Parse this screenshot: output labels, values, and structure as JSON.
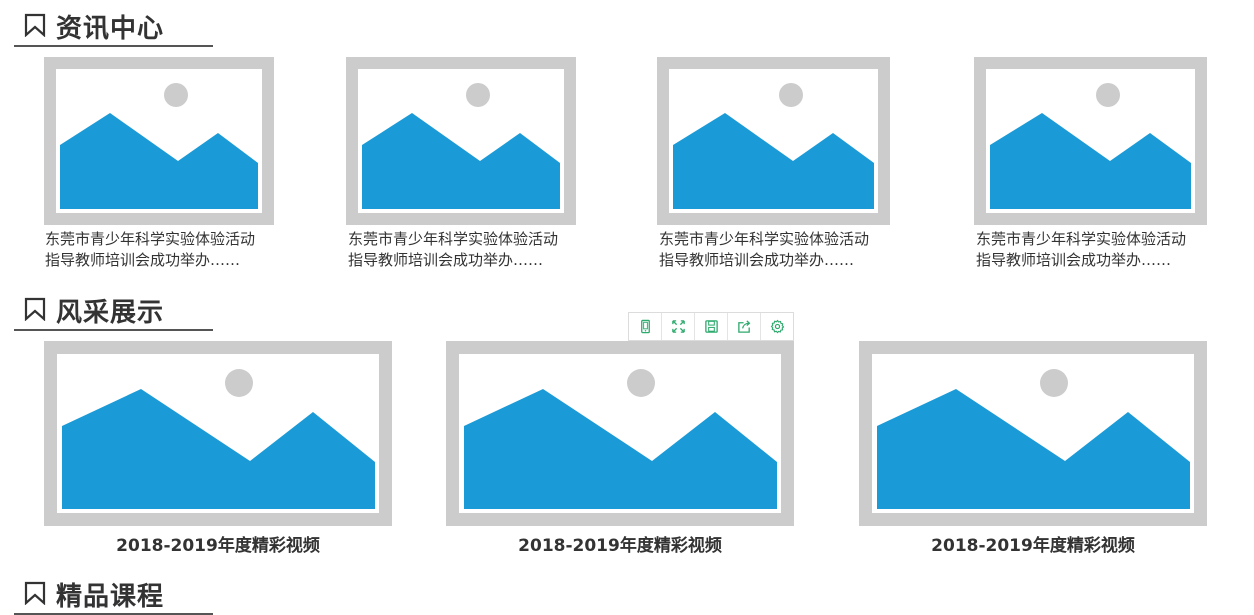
{
  "sections": {
    "news": {
      "title": "资讯中心"
    },
    "showcase": {
      "title": "风采展示"
    },
    "courses": {
      "title": "精品课程"
    }
  },
  "news_items": [
    {
      "line1": "东莞市青少年科学实验体验活动",
      "line2": "指导教师培训会成功举办……"
    },
    {
      "line1": "东莞市青少年科学实验体验活动",
      "line2": "指导教师培训会成功举办……"
    },
    {
      "line1": "东莞市青少年科学实验体验活动",
      "line2": "指导教师培训会成功举办……"
    },
    {
      "line1": "东莞市青少年科学实验体验活动",
      "line2": "指导教师培训会成功举办……"
    }
  ],
  "video_items": [
    {
      "caption": "2018-2019年度精彩视频"
    },
    {
      "caption": "2018-2019年度精彩视频"
    },
    {
      "caption": "2018-2019年度精彩视频"
    }
  ],
  "toolbar": {
    "tools": [
      {
        "icon": "mobile-icon"
      },
      {
        "icon": "expand-icon"
      },
      {
        "icon": "save-icon"
      },
      {
        "icon": "share-icon"
      },
      {
        "icon": "gear-icon"
      }
    ]
  },
  "colors": {
    "mountain": "#1a9ad6",
    "frame": "#cccccc",
    "sun": "#cccccc",
    "tool_accent": "#2eaa6e"
  }
}
